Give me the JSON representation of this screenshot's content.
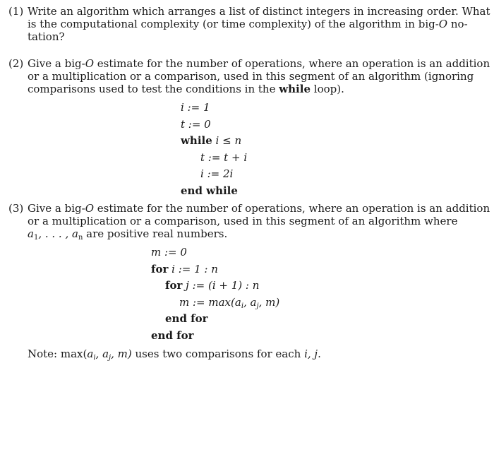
{
  "problems": [
    {
      "number": "(1)",
      "lines": [
        [
          "Write an algorithm which arranges a list of distinct integers in increasing order. What"
        ],
        [
          "is the computational complexity (or time complexity) of the algorithm in big-",
          "O",
          " no-"
        ],
        [
          "tation?"
        ]
      ]
    },
    {
      "number": "(2)",
      "lines": [
        [
          "Give a big-",
          "O",
          " estimate for the number of operations, where an operation is an addition"
        ],
        [
          "or a multiplication or a comparison, used in this segment of an algorithm (ignoring"
        ],
        [
          "comparisons used to test the conditions in the ",
          "while",
          " loop)."
        ]
      ],
      "code": [
        {
          "math": "i := 1"
        },
        {
          "math": "t := 0"
        },
        {
          "kw": "while",
          "math": "i ≤ n"
        },
        {
          "math": "t := t + i"
        },
        {
          "math": "i := 2i"
        },
        {
          "kw": "end while"
        }
      ]
    },
    {
      "number": "(3)",
      "lines": [
        [
          "Give a big-",
          "O",
          " estimate for the number of operations, where an operation is an addition"
        ],
        [
          "or a multiplication or a comparison, used in this segment of an algorithm where"
        ],
        [
          "a",
          "1",
          ", . . . , a",
          "n",
          " are positive real numbers."
        ]
      ],
      "code": [
        {
          "math": "m := 0"
        },
        {
          "kw": "for",
          "math": "i := 1 : n"
        },
        {
          "kw": "for",
          "math": "j := (i + 1) : n"
        },
        {
          "math": "m := max(a",
          "sub1": "i",
          "mid": ", a",
          "sub2": "j",
          "end": ", m)"
        },
        {
          "kw": "end for"
        },
        {
          "kw": "end for"
        }
      ],
      "note": {
        "prefix": "Note: max(",
        "a1": "a",
        "s1": "i",
        "a2": ", a",
        "s2": "j",
        "rest": ", m)",
        "suffix": " uses two comparisons for each ",
        "vars": "i, j",
        "end": "."
      }
    }
  ]
}
